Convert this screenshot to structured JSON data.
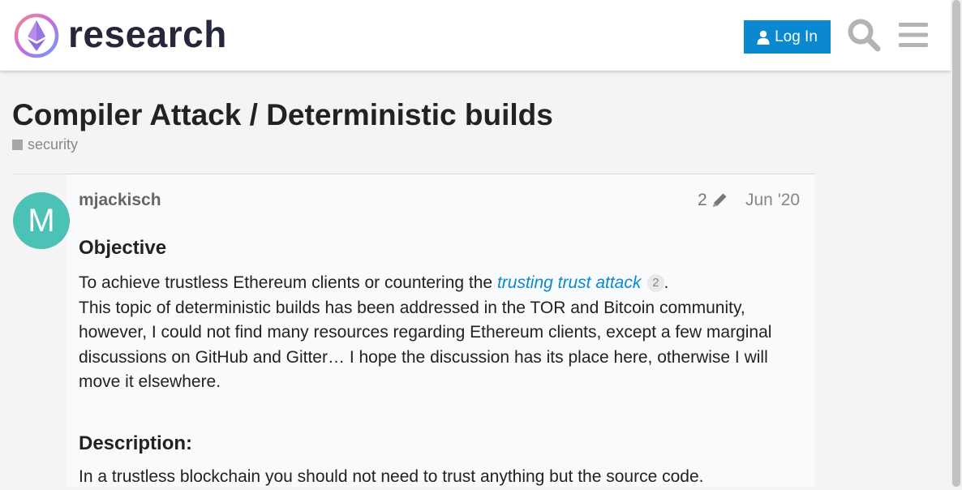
{
  "header": {
    "brand": "research",
    "login_label": "Log In",
    "icons": {
      "logo": "ethereum-research-logo",
      "user": "user-icon",
      "search": "search-icon",
      "menu": "hamburger-menu-icon"
    },
    "accent": "#0a89d1"
  },
  "topic": {
    "title": "Compiler Attack / Deterministic builds",
    "category": "security",
    "category_color": "#a6a6a6"
  },
  "post": {
    "avatar_letter": "M",
    "avatar_color": "#4bc2b5",
    "username": "mjackisch",
    "edit_count": "2",
    "date": "Jun '20",
    "heading_objective": "Objective",
    "p1_before": "To achieve trustless Ethereum clients or countering the ",
    "p1_link": "trusting trust attack",
    "p1_link_clicks": "2",
    "p1_after": ".",
    "p2": "This topic of deterministic builds has been addressed in the TOR and Bitcoin community, however, I could not find many resources regarding Ethereum clients, except a few marginal discussions on GitHub and Gitter… I hope the discussion has its place here, otherwise I will move it elsewhere.",
    "heading_description": "Description:",
    "p3": "In a trustless blockchain you should not need to trust anything but the source code."
  }
}
